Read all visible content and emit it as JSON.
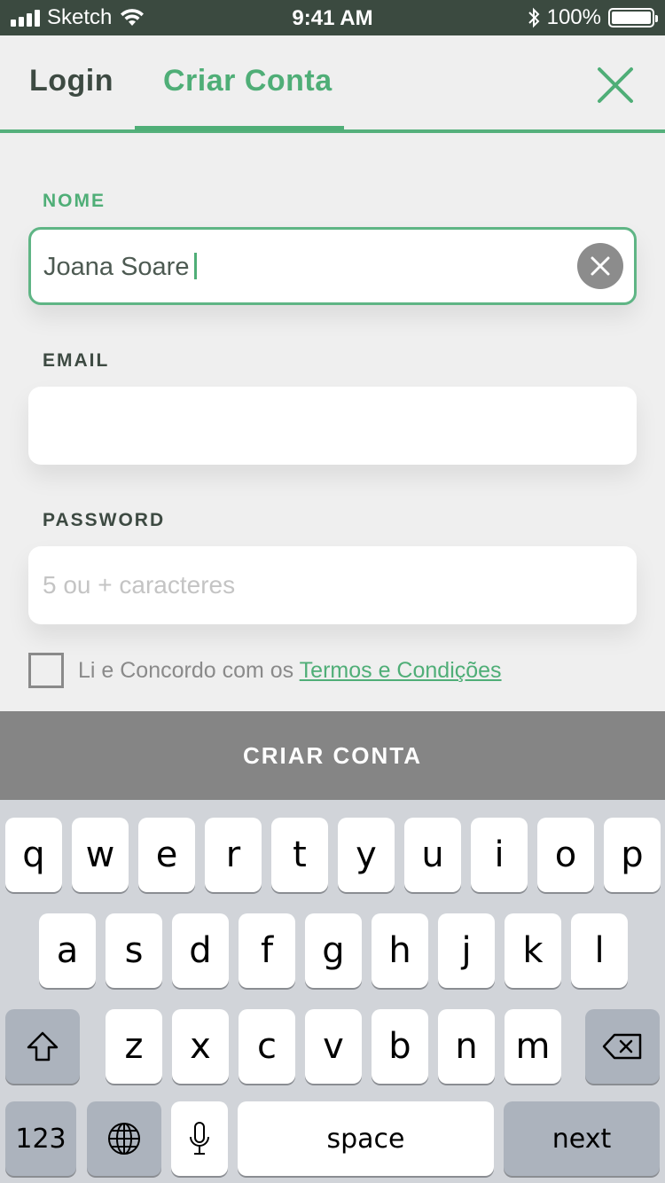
{
  "status_bar": {
    "carrier": "Sketch",
    "time": "9:41 AM",
    "battery": "100%",
    "icons": [
      "signal-icon",
      "wifi-icon",
      "bluetooth-icon",
      "battery-icon"
    ]
  },
  "header": {
    "tabs": [
      {
        "label": "Login",
        "active": false
      },
      {
        "label": "Criar Conta",
        "active": true
      }
    ],
    "close_icon": "close-icon"
  },
  "form": {
    "name": {
      "label": "NOME",
      "value": "Joana Soare"
    },
    "email": {
      "label": "EMAIL",
      "value": ""
    },
    "password": {
      "label": "PASSWORD",
      "placeholder": "5 ou + caracteres"
    }
  },
  "terms": {
    "prefix": "Li e Concordo com os ",
    "link": "Termos e Condições",
    "checked": false
  },
  "cta": {
    "label": "CRIAR CONTA"
  },
  "keyboard": {
    "row1": [
      "q",
      "w",
      "e",
      "r",
      "t",
      "y",
      "u",
      "i",
      "o",
      "p"
    ],
    "row2": [
      "a",
      "s",
      "d",
      "f",
      "g",
      "h",
      "j",
      "k",
      "l"
    ],
    "row3": [
      "z",
      "x",
      "c",
      "v",
      "b",
      "n",
      "m"
    ],
    "numbers": "123",
    "space": "space",
    "next": "next"
  },
  "colors": {
    "accent": "#4fae77",
    "status_bar": "#3b4a40",
    "cta_background": "#858585",
    "keyboard_background": "#d1d4d9"
  }
}
